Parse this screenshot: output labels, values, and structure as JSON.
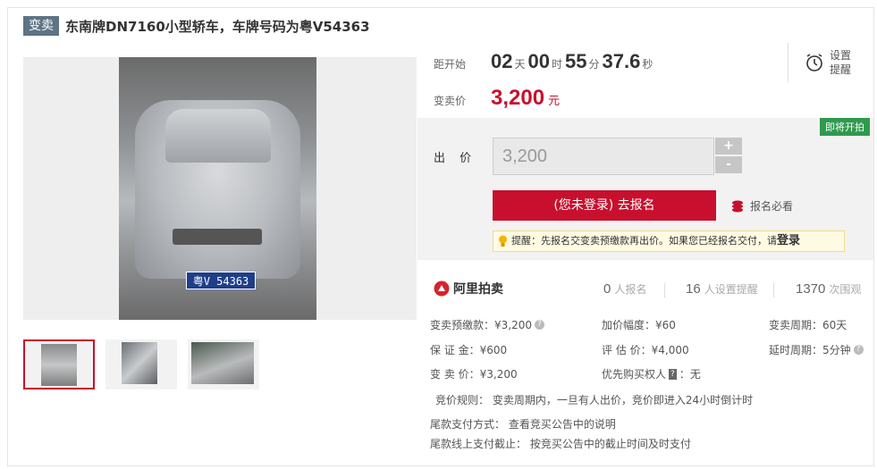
{
  "title": {
    "badge": "变卖",
    "text": "东南牌DN7160小型轿车，车牌号码为粤V54363"
  },
  "gallery": {
    "plate_text": "粤V 54363",
    "thumbnail_count": 3
  },
  "timer": {
    "label": "距开始",
    "days": "02",
    "days_unit": "天",
    "hours": "00",
    "hours_unit": "时",
    "minutes": "55",
    "minutes_unit": "分",
    "seconds": "37.6",
    "seconds_unit": "秒"
  },
  "reminder": {
    "line1": "设置",
    "line2": "提醒"
  },
  "price": {
    "label": "变卖价",
    "value": "3,200",
    "unit": "元"
  },
  "status_badge": "即将开拍",
  "bid": {
    "label": "出 价",
    "value": "3,200",
    "plus": "+",
    "minus": "-",
    "signup_button": "(您未登录) 去报名",
    "must_read": "报名必看",
    "tip_text": "提醒：先报名交变卖预缴款再出价。如果您已经报名交付，请",
    "tip_login": "登录"
  },
  "brand": "阿里拍卖",
  "stats": [
    {
      "value": "0",
      "label": "人报名"
    },
    {
      "value": "16",
      "label": "人设置提醒"
    },
    {
      "value": "1370",
      "label": "次围观"
    }
  ],
  "details": {
    "deposit": "变卖预缴款：¥3,200",
    "bond": "保 证 金：¥600",
    "sell_price": "变 卖 价：¥3,200",
    "increment": "加价幅度：¥60",
    "appraisal": "评 估 价：¥4,000",
    "priority_label": "优先购买权人",
    "priority_value": "无",
    "priority_tag": "?",
    "period": "变卖周期：60天",
    "extension": "延时周期：5分钟"
  },
  "rules": {
    "rule": "竞价规则：  变卖周期内，一旦有人出价，竞价即进入24小时倒计时",
    "payment_method": "尾款支付方式：   查看竞买公告中的说明",
    "payment_deadline": "尾款线上支付截止：   按竞买公告中的截止时间及时支付"
  },
  "colors": {
    "accent": "#c8102e",
    "badge": "#5e7384",
    "green": "#2e9a4e"
  }
}
